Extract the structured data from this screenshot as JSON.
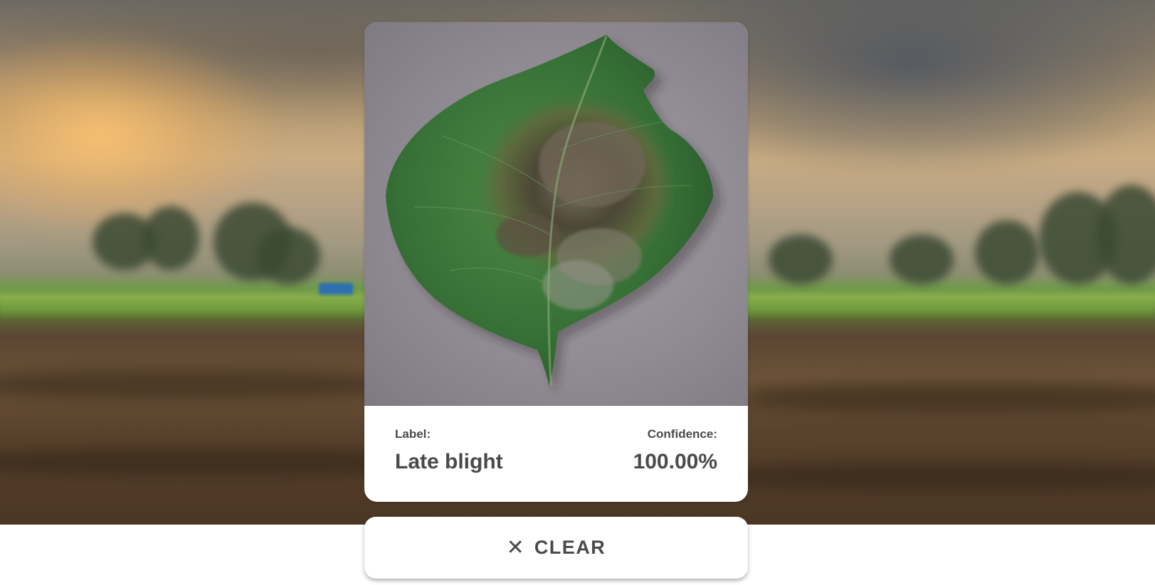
{
  "background": {
    "description_icon": "blurred-farm-field-image"
  },
  "result": {
    "image_icon": "diseased-potato-leaf-photo",
    "label_caption": "Label:",
    "label_value": "Late blight",
    "confidence_caption": "Confidence:",
    "confidence_value": "100.00%"
  },
  "clear_button": {
    "icon": "close-icon",
    "icon_glyph": "✕",
    "label": "CLEAR"
  },
  "colors": {
    "text": "#4a4a4a",
    "card": "#ffffff"
  }
}
